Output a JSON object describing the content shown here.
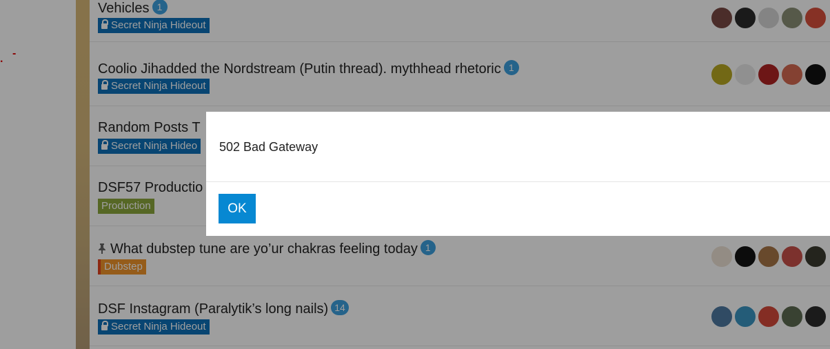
{
  "topics": [
    {
      "title": "Vehicles",
      "reply_count": "1",
      "category": "Secret Ninja Hideout",
      "category_color": "#0d70b8",
      "pinned": false,
      "avatars": [
        "#7a4a44",
        "#2a2a2a",
        "#d6d6d6",
        "#8b9077",
        "#d8503c"
      ]
    },
    {
      "title": "Coolio Jihadded the Nordstream (Putin thread). mythhead rhetoric",
      "reply_count": "1",
      "category": "Secret Ninja Hideout",
      "category_color": "#0d70b8",
      "pinned": false,
      "avatars": [
        "#b8a823",
        "#e8e8e8",
        "#b02424",
        "#d56a52",
        "#111111"
      ]
    },
    {
      "title": "Random Posts T",
      "reply_count": "",
      "category": "Secret Ninja Hideo",
      "category_color": "#0d70b8",
      "pinned": false,
      "avatars": []
    },
    {
      "title": "DSF57 Productio",
      "reply_count": "",
      "category": "Production",
      "category_color": "#8ca63c",
      "pinned": false,
      "avatars": []
    },
    {
      "title": "What dubstep tune are yo’ur chakras feeling today",
      "reply_count": "1",
      "category": "Dubstep",
      "category_color": "#f0952a",
      "pinned": true,
      "avatars": [
        "#ede2d6",
        "#141414",
        "#a97748",
        "#c9504a",
        "#3a3a30"
      ]
    },
    {
      "title": "DSF Instagram (Paralytik’s long nails)",
      "reply_count": "14",
      "category": "Secret Ninja Hideout",
      "category_color": "#0d70b8",
      "pinned": false,
      "avatars": [
        "#4e79a2",
        "#3a95c2",
        "#d54a3a",
        "#5d6b52",
        "#2d2d2d"
      ]
    }
  ],
  "modal": {
    "message": "502 Bad Gateway",
    "ok_label": "OK"
  },
  "left_marks": {
    "dot": ".",
    "dash": "-"
  },
  "colors": {
    "accent_blue": "#0788d2",
    "badge_blue": "#3ca0df",
    "overlay": "rgba(0,0,0,0.38)"
  }
}
